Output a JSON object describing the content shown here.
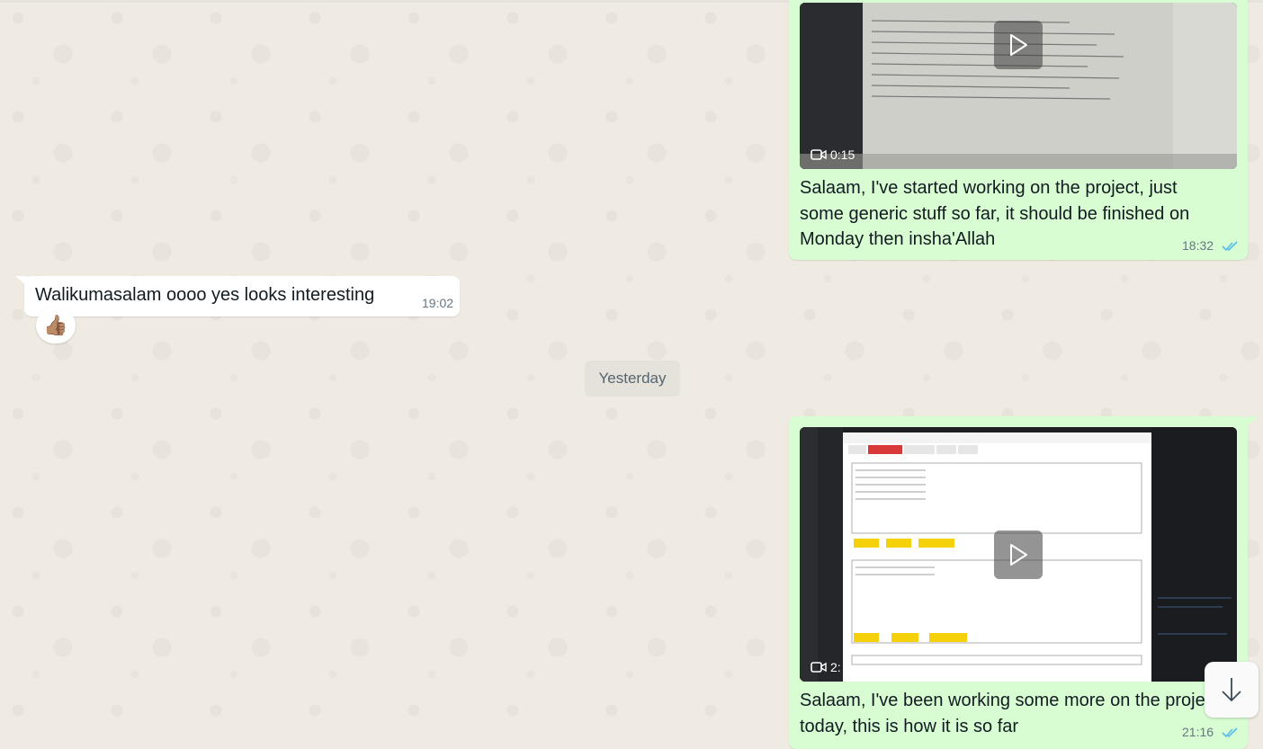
{
  "messages": [
    {
      "direction": "outgoing",
      "type": "video",
      "duration": "0:15",
      "caption": "Salaam, I've started working on the project, just some generic stuff so far, it should be finished on Monday then insha'Allah",
      "time": "18:32",
      "status": "read"
    },
    {
      "direction": "incoming",
      "type": "text",
      "text": "Walikumasalam oooo yes looks interesting",
      "time": "19:02",
      "reaction": "👍🏽"
    },
    {
      "direction": "outgoing",
      "type": "video",
      "duration": "2:",
      "caption": "Salaam, I've been working some more on the project today, this is how it is so far",
      "time": "21:16",
      "status": "read"
    }
  ],
  "date_separator": "Yesterday",
  "colors": {
    "outgoing_bubble": "#d9fdd3",
    "incoming_bubble": "#ffffff",
    "read_ticks": "#53bdeb",
    "chat_background": "#efeae2"
  },
  "icons": {
    "play": "play-icon",
    "video": "video-camera-icon",
    "ticks": "double-check-icon",
    "scroll_down": "arrow-down-icon"
  }
}
